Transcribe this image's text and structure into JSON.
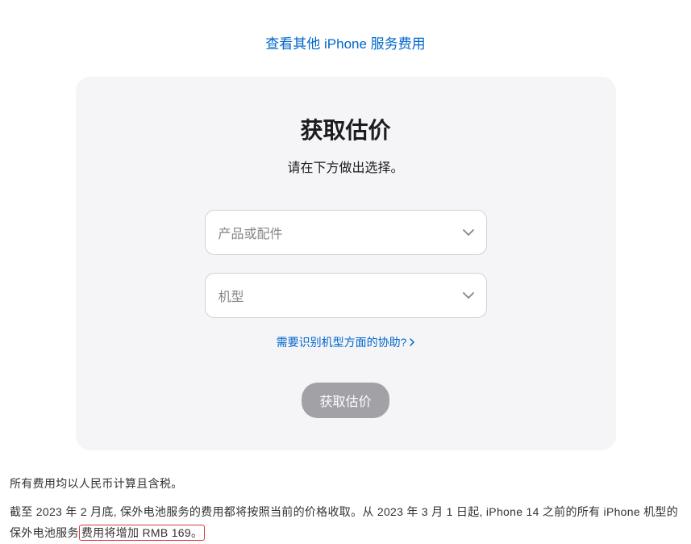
{
  "topLink": {
    "label": "查看其他 iPhone 服务费用"
  },
  "card": {
    "title": "获取估价",
    "subtitle": "请在下方做出选择。",
    "select1": {
      "placeholder": "产品或配件"
    },
    "select2": {
      "placeholder": "机型"
    },
    "helpLink": {
      "label": "需要识别机型方面的协助?"
    },
    "submitButton": {
      "label": "获取估价"
    }
  },
  "footer": {
    "line1": "所有费用均以人民币计算且含税。",
    "line2_part1": "截至 2023 年 2 月底, 保外电池服务的费用都将按照当前的价格收取。从 2023 年 3 月 1 日起, iPhone 14 之前的所有 iPhone 机型的保外电池服务",
    "line2_highlight": "费用将增加 RMB 169。"
  }
}
